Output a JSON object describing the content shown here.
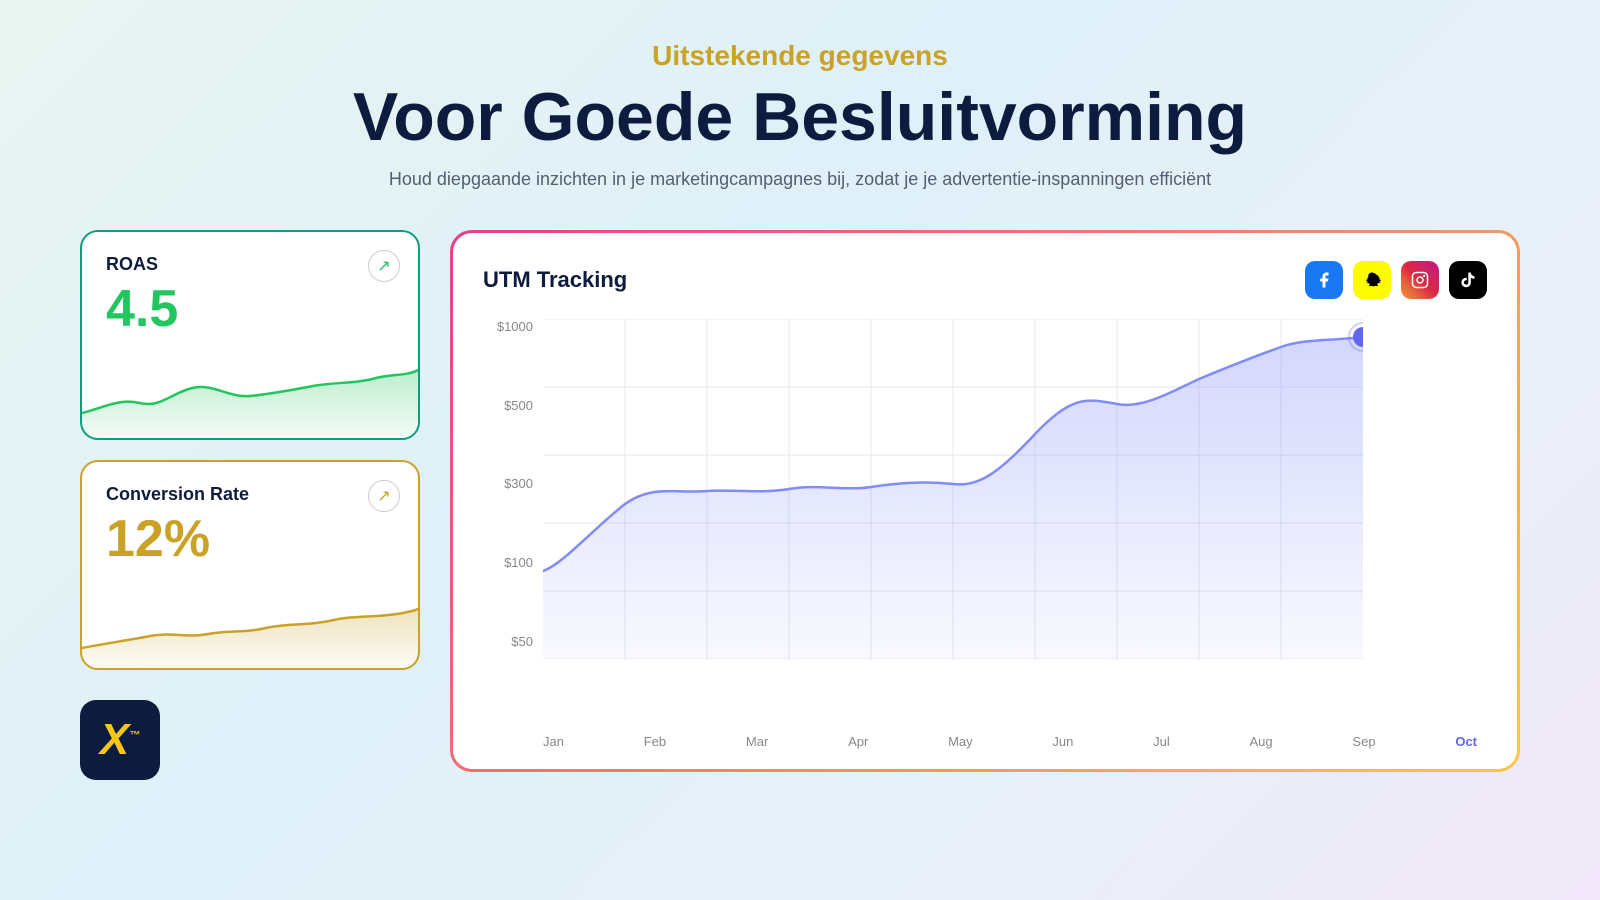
{
  "header": {
    "subtitle": "Uitstekende gegevens",
    "title": "Voor Goede Besluitvorming",
    "description": "Houd diepgaande inzichten in je marketingcampagnes bij, zodat je je advertentie-inspanningen efficiënt"
  },
  "roas_card": {
    "title": "ROAS",
    "value": "4.5",
    "arrow": "↗"
  },
  "conversion_card": {
    "title": "Conversion Rate",
    "value": "12%",
    "arrow": "↗"
  },
  "chart": {
    "title": "UTM Tracking",
    "y_labels": [
      "$1000",
      "$500",
      "$300",
      "$100",
      "$50"
    ],
    "x_labels": [
      "Jan",
      "Feb",
      "Mar",
      "Apr",
      "May",
      "Jun",
      "Jul",
      "Aug",
      "Sep",
      "Oct"
    ],
    "social_icons": [
      {
        "name": "facebook",
        "label": "f"
      },
      {
        "name": "snapchat",
        "label": "👻"
      },
      {
        "name": "instagram",
        "label": "📷"
      },
      {
        "name": "tiktok",
        "label": "♪"
      }
    ]
  },
  "logo": {
    "text": "X",
    "tm": "™"
  },
  "colors": {
    "accent_yellow": "#c9a227",
    "accent_green": "#22c55e",
    "accent_blue": "#0d1b3e",
    "chart_purple": "#a5b4fc"
  }
}
